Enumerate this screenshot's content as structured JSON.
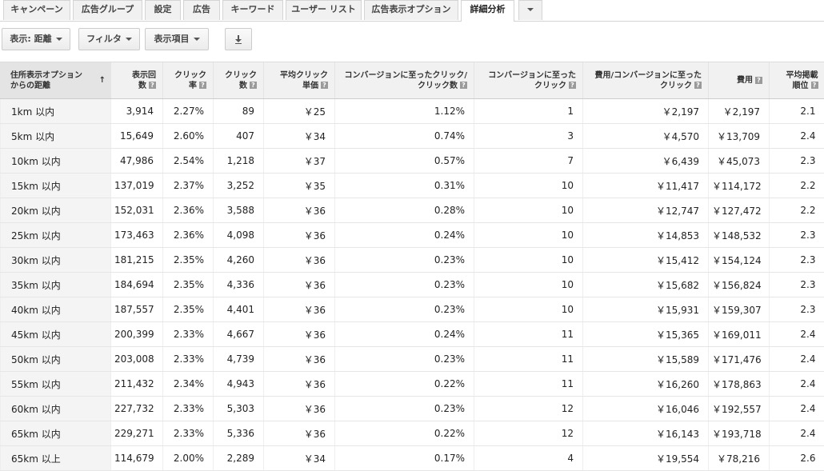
{
  "tabs": [
    {
      "label": "キャンペーン"
    },
    {
      "label": "広告グループ"
    },
    {
      "label": "設定"
    },
    {
      "label": "広告"
    },
    {
      "label": "キーワード"
    },
    {
      "label": "ユーザー リスト"
    },
    {
      "label": "広告表示オプション"
    },
    {
      "label": "詳細分析",
      "active": true
    }
  ],
  "toolbar": {
    "view_label": "表示: 距離",
    "filter_label": "フィルタ",
    "columns_label": "表示項目",
    "download_icon": "download-icon"
  },
  "table": {
    "headers": [
      {
        "line1": "住所表示オプション",
        "line2": "からの距離"
      },
      {
        "line1": "表示回",
        "line2": "数"
      },
      {
        "line1": "クリック",
        "line2": "率"
      },
      {
        "line1": "クリック",
        "line2": "数"
      },
      {
        "line1": "平均クリック",
        "line2": "単価"
      },
      {
        "line1": "コンバージョンに至ったクリック/",
        "line2": "クリック数"
      },
      {
        "line1": "コンバージョンに至った",
        "line2": "クリック"
      },
      {
        "line1": "費用/コンバージョンに至った",
        "line2": "クリック"
      },
      {
        "line1": "",
        "line2": "費用"
      },
      {
        "line1": "平均掲載",
        "line2": "順位"
      }
    ],
    "sort_indicator": "↑",
    "rows": [
      [
        "1km 以内",
        "3,914",
        "2.27%",
        "89",
        "￥25",
        "1.12%",
        "1",
        "￥2,197",
        "￥2,197",
        "2.1"
      ],
      [
        "5km 以内",
        "15,649",
        "2.60%",
        "407",
        "￥34",
        "0.74%",
        "3",
        "￥4,570",
        "￥13,709",
        "2.4"
      ],
      [
        "10km 以内",
        "47,986",
        "2.54%",
        "1,218",
        "￥37",
        "0.57%",
        "7",
        "￥6,439",
        "￥45,073",
        "2.3"
      ],
      [
        "15km 以内",
        "137,019",
        "2.37%",
        "3,252",
        "￥35",
        "0.31%",
        "10",
        "￥11,417",
        "￥114,172",
        "2.2"
      ],
      [
        "20km 以内",
        "152,031",
        "2.36%",
        "3,588",
        "￥36",
        "0.28%",
        "10",
        "￥12,747",
        "￥127,472",
        "2.2"
      ],
      [
        "25km 以内",
        "173,463",
        "2.36%",
        "4,098",
        "￥36",
        "0.24%",
        "10",
        "￥14,853",
        "￥148,532",
        "2.3"
      ],
      [
        "30km 以内",
        "181,215",
        "2.35%",
        "4,260",
        "￥36",
        "0.23%",
        "10",
        "￥15,412",
        "￥154,124",
        "2.3"
      ],
      [
        "35km 以内",
        "184,694",
        "2.35%",
        "4,336",
        "￥36",
        "0.23%",
        "10",
        "￥15,682",
        "￥156,824",
        "2.3"
      ],
      [
        "40km 以内",
        "187,557",
        "2.35%",
        "4,401",
        "￥36",
        "0.23%",
        "10",
        "￥15,931",
        "￥159,307",
        "2.3"
      ],
      [
        "45km 以内",
        "200,399",
        "2.33%",
        "4,667",
        "￥36",
        "0.24%",
        "11",
        "￥15,365",
        "￥169,011",
        "2.4"
      ],
      [
        "50km 以内",
        "203,008",
        "2.33%",
        "4,739",
        "￥36",
        "0.23%",
        "11",
        "￥15,589",
        "￥171,476",
        "2.4"
      ],
      [
        "55km 以内",
        "211,432",
        "2.34%",
        "4,943",
        "￥36",
        "0.22%",
        "11",
        "￥16,260",
        "￥178,863",
        "2.4"
      ],
      [
        "60km 以内",
        "227,732",
        "2.33%",
        "5,303",
        "￥36",
        "0.23%",
        "12",
        "￥16,046",
        "￥192,557",
        "2.4"
      ],
      [
        "65km 以内",
        "229,271",
        "2.33%",
        "5,336",
        "￥36",
        "0.22%",
        "12",
        "￥16,143",
        "￥193,718",
        "2.4"
      ],
      [
        "65km 以上",
        "114,679",
        "2.00%",
        "2,289",
        "￥34",
        "0.17%",
        "4",
        "￥19,554",
        "￥78,216",
        "2.6"
      ]
    ]
  }
}
